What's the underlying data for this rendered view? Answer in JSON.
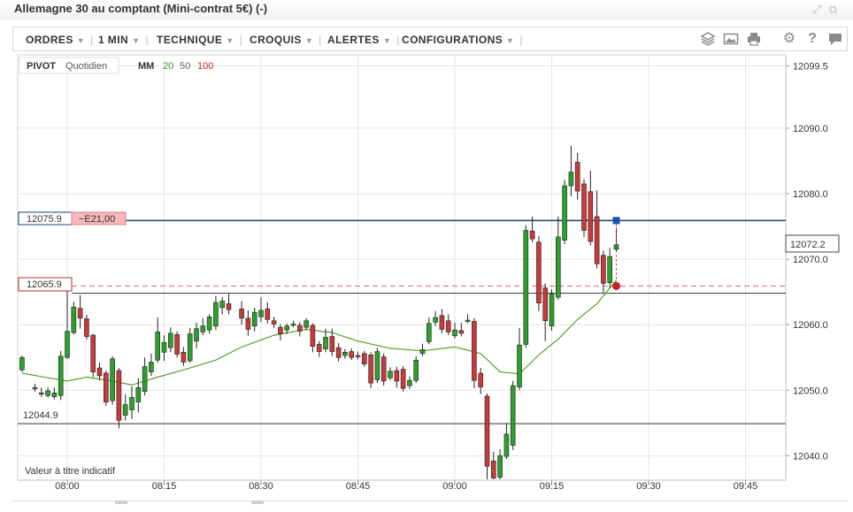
{
  "window": {
    "title": "Allemagne 30 au comptant (Mini-contrat 5€) (-)",
    "icons": [
      "expand-icon",
      "popout-icon"
    ]
  },
  "toolbar": {
    "menus": [
      {
        "label": "ORDRES"
      },
      {
        "label": "1 MIN"
      },
      {
        "label": "TECHNIQUE"
      },
      {
        "label": "CROQUIS"
      },
      {
        "label": "ALERTES"
      },
      {
        "label": "CONFIGURATIONS"
      }
    ],
    "icons": [
      "layers-icon",
      "image-icon",
      "print-icon",
      "gear-icon",
      "help-icon",
      "chat-icon"
    ]
  },
  "legend": {
    "pivot_label": "PIVOT",
    "pivot_period": "Quotidien",
    "ma_label": "MM",
    "ma_periods": [
      "20",
      "50",
      "100"
    ],
    "ma_colors": [
      "#3a9a1e",
      "#666666",
      "#cc1f1f"
    ]
  },
  "position_tags": {
    "entry_price": "12075.9",
    "pnl": "−E21,00",
    "stop_price": "12065.9",
    "pivot_level": "12044.9"
  },
  "current_price": "12072.2",
  "footnote": "Valeur à titre indicatif",
  "colors": {
    "up": "#2e9e2e",
    "down": "#c83a3a",
    "entry_line": "#1a3e7a",
    "stop_line": "#d9808a",
    "ma_line": "#5a9e2a",
    "marker_blue": "#1d4fa8",
    "marker_red": "#c8202a"
  },
  "chart_data": {
    "type": "candlestick",
    "timeframe": "1 MIN",
    "x_ticks": [
      "08:00",
      "08:15",
      "08:30",
      "08:45",
      "09:00",
      "09:15",
      "09:30",
      "09:45"
    ],
    "y_ticks": [
      "12099.5",
      "12090.0",
      "12080.0",
      "12070.0",
      "12060.0",
      "12050.0",
      "12040.0"
    ],
    "ylim": [
      12036,
      12101
    ],
    "horizontal_levels": {
      "entry": 12075.9,
      "stop": 12065.9,
      "support": 12064.8,
      "pivot": 12044.9
    },
    "candles": [
      {
        "t": "07:53",
        "o": 12053.1,
        "c": 12055.0,
        "h": 12055.3,
        "l": 12052.8
      },
      {
        "t": "07:55",
        "o": 12050.4,
        "c": 12050.4,
        "h": 12051.0,
        "l": 12049.8
      },
      {
        "t": "07:56",
        "o": 12049.6,
        "c": 12049.6,
        "h": 12050.4,
        "l": 12049.0
      },
      {
        "t": "07:57",
        "o": 12049.2,
        "c": 12049.9,
        "h": 12050.4,
        "l": 12048.9
      },
      {
        "t": "07:58",
        "o": 12049.0,
        "c": 12049.6,
        "h": 12050.4,
        "l": 12048.6
      },
      {
        "t": "07:59",
        "o": 12049.2,
        "c": 12055.2,
        "h": 12056.0,
        "l": 12048.5
      },
      {
        "t": "08:00",
        "o": 12055.0,
        "c": 12059.0,
        "h": 12066.0,
        "l": 12054.8
      },
      {
        "t": "08:01",
        "o": 12058.8,
        "c": 12062.7,
        "h": 12063.5,
        "l": 12058.5
      },
      {
        "t": "08:02",
        "o": 12062.5,
        "c": 12061.0,
        "h": 12064.5,
        "l": 12059.4
      },
      {
        "t": "08:03",
        "o": 12060.9,
        "c": 12058.2,
        "h": 12061.5,
        "l": 12057.7
      },
      {
        "t": "08:04",
        "o": 12058.4,
        "c": 12052.8,
        "h": 12058.6,
        "l": 12052.0
      },
      {
        "t": "08:05",
        "o": 12053.4,
        "c": 12052.2,
        "h": 12054.2,
        "l": 12051.5
      },
      {
        "t": "08:06",
        "o": 12052.6,
        "c": 12048.2,
        "h": 12053.0,
        "l": 12047.6
      },
      {
        "t": "08:07",
        "o": 12048.4,
        "c": 12054.8,
        "h": 12055.2,
        "l": 12047.8
      },
      {
        "t": "08:08",
        "o": 12053.0,
        "c": 12045.4,
        "h": 12053.4,
        "l": 12044.2
      },
      {
        "t": "08:09",
        "o": 12046.2,
        "c": 12047.8,
        "h": 12049.4,
        "l": 12045.4
      },
      {
        "t": "08:10",
        "o": 12047.0,
        "c": 12048.9,
        "h": 12050.6,
        "l": 12045.6
      },
      {
        "t": "08:11",
        "o": 12048.2,
        "c": 12050.4,
        "h": 12051.8,
        "l": 12046.6
      },
      {
        "t": "08:12",
        "o": 12049.8,
        "c": 12053.6,
        "h": 12055.0,
        "l": 12049.2
      },
      {
        "t": "08:13",
        "o": 12052.8,
        "c": 12054.3,
        "h": 12055.6,
        "l": 12052.2
      },
      {
        "t": "08:14",
        "o": 12054.6,
        "c": 12058.9,
        "h": 12061.1,
        "l": 12054.2
      },
      {
        "t": "08:15",
        "o": 12055.8,
        "c": 12057.3,
        "h": 12058.4,
        "l": 12054.5
      },
      {
        "t": "08:16",
        "o": 12056.5,
        "c": 12058.7,
        "h": 12059.6,
        "l": 12055.8
      },
      {
        "t": "08:17",
        "o": 12058.5,
        "c": 12055.5,
        "h": 12059.0,
        "l": 12055.0
      },
      {
        "t": "08:18",
        "o": 12055.8,
        "c": 12054.3,
        "h": 12056.6,
        "l": 12053.7
      },
      {
        "t": "08:19",
        "o": 12054.5,
        "c": 12058.6,
        "h": 12059.5,
        "l": 12054.2
      },
      {
        "t": "08:20",
        "o": 12057.5,
        "c": 12059.4,
        "h": 12060.3,
        "l": 12056.4
      },
      {
        "t": "08:21",
        "o": 12058.9,
        "c": 12059.8,
        "h": 12061.0,
        "l": 12058.4
      },
      {
        "t": "08:22",
        "o": 12059.2,
        "c": 12061.2,
        "h": 12061.6,
        "l": 12058.6
      },
      {
        "t": "08:23",
        "o": 12059.8,
        "c": 12063.4,
        "h": 12064.4,
        "l": 12059.2
      },
      {
        "t": "08:24",
        "o": 12062.6,
        "c": 12063.6,
        "h": 12064.2,
        "l": 12061.6
      },
      {
        "t": "08:25",
        "o": 12063.2,
        "c": 12062.3,
        "h": 12064.7,
        "l": 12061.6
      },
      {
        "t": "08:27",
        "o": 12062.4,
        "c": 12061.0,
        "h": 12063.6,
        "l": 12060.0
      },
      {
        "t": "08:28",
        "o": 12061.0,
        "c": 12059.3,
        "h": 12062.2,
        "l": 12058.3
      },
      {
        "t": "08:29",
        "o": 12059.8,
        "c": 12061.9,
        "h": 12062.6,
        "l": 12059.0
      },
      {
        "t": "08:30",
        "o": 12061.2,
        "c": 12062.2,
        "h": 12064.2,
        "l": 12060.4
      },
      {
        "t": "08:31",
        "o": 12062.4,
        "c": 12060.8,
        "h": 12063.4,
        "l": 12060.2
      },
      {
        "t": "08:32",
        "o": 12060.6,
        "c": 12060.1,
        "h": 12061.2,
        "l": 12059.5
      },
      {
        "t": "08:33",
        "o": 12059.6,
        "c": 12058.6,
        "h": 12060.1,
        "l": 12057.6
      },
      {
        "t": "08:34",
        "o": 12059.2,
        "c": 12059.8,
        "h": 12060.2,
        "l": 12058.6
      },
      {
        "t": "08:35",
        "o": 12060.1,
        "c": 12060.1,
        "h": 12060.6,
        "l": 12059.6
      },
      {
        "t": "08:36",
        "o": 12059.9,
        "c": 12059.0,
        "h": 12060.4,
        "l": 12058.2
      },
      {
        "t": "08:37",
        "o": 12059.6,
        "c": 12060.6,
        "h": 12061.0,
        "l": 12059.2
      },
      {
        "t": "08:38",
        "o": 12059.9,
        "c": 12056.7,
        "h": 12060.2,
        "l": 12055.8
      },
      {
        "t": "08:39",
        "o": 12057.0,
        "c": 12055.9,
        "h": 12057.5,
        "l": 12055.1
      },
      {
        "t": "08:40",
        "o": 12056.3,
        "c": 12058.1,
        "h": 12059.4,
        "l": 12055.8
      },
      {
        "t": "08:41",
        "o": 12058.2,
        "c": 12055.9,
        "h": 12059.4,
        "l": 12055.2
      },
      {
        "t": "08:42",
        "o": 12056.5,
        "c": 12055.0,
        "h": 12057.2,
        "l": 12054.4
      },
      {
        "t": "08:43",
        "o": 12055.3,
        "c": 12055.8,
        "h": 12056.3,
        "l": 12054.8
      },
      {
        "t": "08:44",
        "o": 12055.9,
        "c": 12055.0,
        "h": 12056.4,
        "l": 12054.6
      },
      {
        "t": "08:45",
        "o": 12055.3,
        "c": 12055.1,
        "h": 12055.9,
        "l": 12054.7
      },
      {
        "t": "08:46",
        "o": 12055.6,
        "c": 12054.0,
        "h": 12056.0,
        "l": 12053.6
      },
      {
        "t": "08:47",
        "o": 12055.4,
        "c": 12051.1,
        "h": 12055.8,
        "l": 12050.3
      },
      {
        "t": "08:48",
        "o": 12051.6,
        "c": 12055.9,
        "h": 12056.5,
        "l": 12051.1
      },
      {
        "t": "08:49",
        "o": 12055.1,
        "c": 12051.4,
        "h": 12055.6,
        "l": 12050.7
      },
      {
        "t": "08:50",
        "o": 12051.9,
        "c": 12052.9,
        "h": 12053.5,
        "l": 12051.5
      },
      {
        "t": "08:51",
        "o": 12053.0,
        "c": 12051.4,
        "h": 12053.6,
        "l": 12050.4
      },
      {
        "t": "08:52",
        "o": 12053.2,
        "c": 12050.3,
        "h": 12053.7,
        "l": 12049.8
      },
      {
        "t": "08:53",
        "o": 12050.7,
        "c": 12051.5,
        "h": 12052.1,
        "l": 12050.2
      },
      {
        "t": "08:54",
        "o": 12051.5,
        "c": 12054.6,
        "h": 12055.2,
        "l": 12051.1
      },
      {
        "t": "08:55",
        "o": 12055.6,
        "c": 12056.2,
        "h": 12057.1,
        "l": 12055.2
      },
      {
        "t": "08:56",
        "o": 12057.4,
        "c": 12060.2,
        "h": 12061.1,
        "l": 12057.0
      },
      {
        "t": "08:57",
        "o": 12060.4,
        "c": 12061.1,
        "h": 12062.1,
        "l": 12059.8
      },
      {
        "t": "08:58",
        "o": 12061.4,
        "c": 12059.3,
        "h": 12062.4,
        "l": 12058.7
      },
      {
        "t": "08:59",
        "o": 12060.6,
        "c": 12058.9,
        "h": 12061.6,
        "l": 12058.4
      },
      {
        "t": "09:00",
        "o": 12058.3,
        "c": 12059.2,
        "h": 12060.3,
        "l": 12057.9
      },
      {
        "t": "09:01",
        "o": 12059.1,
        "c": 12058.7,
        "h": 12060.3,
        "l": 12058.2
      },
      {
        "t": "09:02",
        "o": 12060.7,
        "c": 12060.7,
        "h": 12061.6,
        "l": 12060.2
      },
      {
        "t": "09:03",
        "o": 12060.5,
        "c": 12051.5,
        "h": 12061.0,
        "l": 12050.3
      },
      {
        "t": "09:04",
        "o": 12052.6,
        "c": 12050.5,
        "h": 12053.4,
        "l": 12049.4
      },
      {
        "t": "09:05",
        "o": 12049.1,
        "c": 12038.4,
        "h": 12049.5,
        "l": 12036.0
      },
      {
        "t": "09:06",
        "o": 12039.2,
        "c": 12036.6,
        "h": 12040.6,
        "l": 12033.7
      },
      {
        "t": "09:07",
        "o": 12036.7,
        "c": 12040.0,
        "h": 12041.0,
        "l": 12035.8
      },
      {
        "t": "09:08",
        "o": 12039.9,
        "c": 12043.3,
        "h": 12045.0,
        "l": 12039.5
      },
      {
        "t": "09:09",
        "o": 12041.6,
        "c": 12050.7,
        "h": 12051.4,
        "l": 12040.9
      },
      {
        "t": "09:10",
        "o": 12050.5,
        "c": 12056.9,
        "h": 12059.5,
        "l": 12050.0
      },
      {
        "t": "09:11",
        "o": 12057.0,
        "c": 12074.4,
        "h": 12075.2,
        "l": 12056.5
      },
      {
        "t": "09:12",
        "o": 12074.3,
        "c": 12073.1,
        "h": 12076.5,
        "l": 12072.6
      },
      {
        "t": "09:13",
        "o": 12072.6,
        "c": 12063.3,
        "h": 12073.5,
        "l": 12062.1
      },
      {
        "t": "09:14",
        "o": 12065.6,
        "c": 12060.6,
        "h": 12066.3,
        "l": 12057.5
      },
      {
        "t": "09:15",
        "o": 12059.8,
        "c": 12064.7,
        "h": 12065.4,
        "l": 12059.1
      },
      {
        "t": "09:16",
        "o": 12064.2,
        "c": 12073.4,
        "h": 12076.5,
        "l": 12063.8
      },
      {
        "t": "09:17",
        "o": 12072.9,
        "c": 12081.2,
        "h": 12082.1,
        "l": 12072.3
      },
      {
        "t": "09:18",
        "o": 12081.2,
        "c": 12083.3,
        "h": 12087.3,
        "l": 12079.6
      },
      {
        "t": "09:19",
        "o": 12084.8,
        "c": 12080.4,
        "h": 12086.2,
        "l": 12079.1
      },
      {
        "t": "09:20",
        "o": 12081.5,
        "c": 12074.4,
        "h": 12082.2,
        "l": 12073.4
      },
      {
        "t": "09:21",
        "o": 12080.3,
        "c": 12072.7,
        "h": 12083.5,
        "l": 12072.1
      },
      {
        "t": "09:22",
        "o": 12076.5,
        "c": 12069.3,
        "h": 12080.5,
        "l": 12068.6
      },
      {
        "t": "09:23",
        "o": 12070.6,
        "c": 12066.3,
        "h": 12071.3,
        "l": 12064.8
      },
      {
        "t": "09:24",
        "o": 12066.4,
        "c": 12070.4,
        "h": 12071.7,
        "l": 12065.6
      },
      {
        "t": "09:25",
        "o": 12071.5,
        "c": 12072.2,
        "h": 12074.8,
        "l": 12071.3
      }
    ],
    "ma20": [
      {
        "t": "07:53",
        "v": 12052.6
      },
      {
        "t": "07:57",
        "v": 12051.9
      },
      {
        "t": "08:00",
        "v": 12051.4
      },
      {
        "t": "08:03",
        "v": 12052.0
      },
      {
        "t": "08:07",
        "v": 12051.4
      },
      {
        "t": "08:10",
        "v": 12050.8
      },
      {
        "t": "08:14",
        "v": 12052.0
      },
      {
        "t": "08:18",
        "v": 12053.1
      },
      {
        "t": "08:23",
        "v": 12054.6
      },
      {
        "t": "08:27",
        "v": 12056.6
      },
      {
        "t": "08:32",
        "v": 12058.4
      },
      {
        "t": "08:37",
        "v": 12059.3
      },
      {
        "t": "08:41",
        "v": 12058.8
      },
      {
        "t": "08:45",
        "v": 12057.5
      },
      {
        "t": "08:50",
        "v": 12056.4
      },
      {
        "t": "08:55",
        "v": 12056.0
      },
      {
        "t": "09:00",
        "v": 12056.6
      },
      {
        "t": "09:04",
        "v": 12055.6
      },
      {
        "t": "09:07",
        "v": 12052.8
      },
      {
        "t": "09:10",
        "v": 12052.5
      },
      {
        "t": "09:13",
        "v": 12055.4
      },
      {
        "t": "09:16",
        "v": 12057.8
      },
      {
        "t": "09:19",
        "v": 12060.8
      },
      {
        "t": "09:22",
        "v": 12063.2
      },
      {
        "t": "09:25",
        "v": 12066.8
      }
    ]
  }
}
